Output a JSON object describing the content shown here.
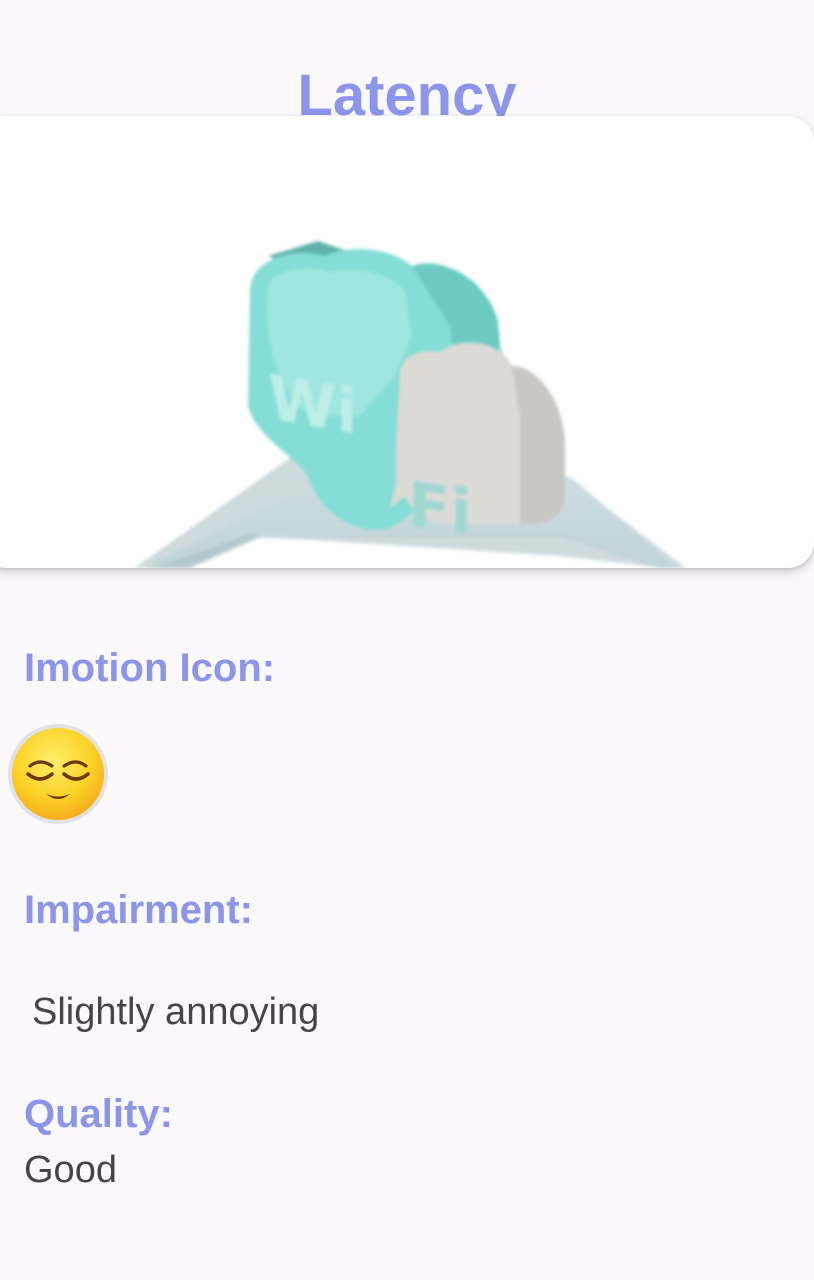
{
  "header": {
    "title": "Latency"
  },
  "hero": {
    "image_icon": "wifi-cloud-icon",
    "image_text_top": "Wi",
    "image_text_bottom": "Fi"
  },
  "emotion": {
    "label": "Imotion Icon:",
    "icon": "relieved-face-icon"
  },
  "impairment": {
    "label": "Impairment:",
    "value": "Slightly annoying"
  },
  "quality": {
    "label": "Quality:",
    "value": "Good"
  },
  "colors": {
    "accent": "#8c95ea",
    "text": "#46434a",
    "background": "#fcf9fd",
    "teal": "#82ddd6",
    "platform": "#cbdde0"
  }
}
